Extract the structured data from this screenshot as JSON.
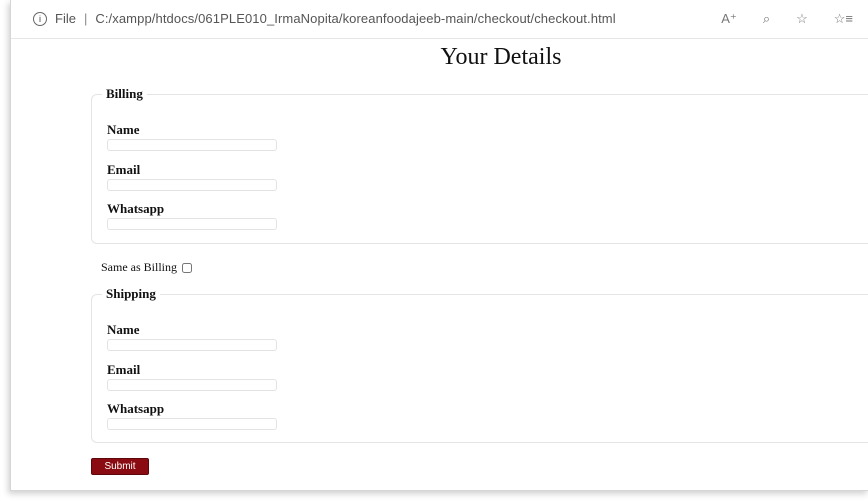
{
  "browser": {
    "info_symbol": "i",
    "scheme_label": "File",
    "separator": "|",
    "url": "C:/xampp/htdocs/061PLE010_IrmaNopita/koreanfoodajeeb-main/checkout/checkout.html",
    "tools": [
      "A⁺",
      "⌕",
      "☆",
      "☆≡"
    ]
  },
  "page": {
    "title": "Your Details"
  },
  "billing": {
    "legend": "Billing",
    "fields": [
      {
        "label": "Name",
        "value": ""
      },
      {
        "label": "Email",
        "value": ""
      },
      {
        "label": "Whatsapp",
        "value": ""
      }
    ]
  },
  "same_as_billing": {
    "label": "Same as Billing",
    "checked": false
  },
  "shipping": {
    "legend": "Shipping",
    "fields": [
      {
        "label": "Name",
        "value": ""
      },
      {
        "label": "Email",
        "value": ""
      },
      {
        "label": "Whatsapp",
        "value": ""
      }
    ]
  },
  "submit": {
    "label": "Submit",
    "color": "#8a0c12"
  }
}
